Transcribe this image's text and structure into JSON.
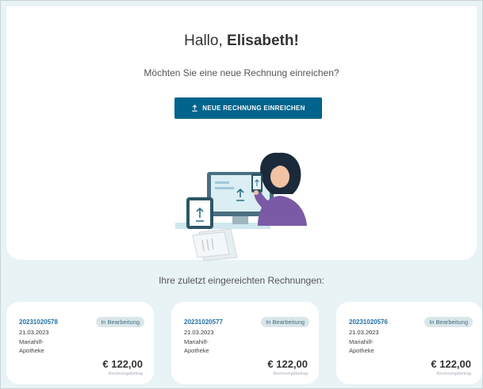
{
  "hero": {
    "greeting_prefix": "Hallo,",
    "greeting_name": "Elisabeth!",
    "subtitle": "Möchten Sie eine neue Rechnung einreichen?",
    "cta_label": "NEUE RECHNUNG EINREICHEN"
  },
  "recent": {
    "title": "Ihre zuletzt eingereichten Rechnungen:",
    "cards": [
      {
        "number": "20231020578",
        "status": "In Bearbeitung",
        "date": "21.03.2023",
        "pharmacy_line1": "Mariahilf-",
        "pharmacy_line2": "Apotheke",
        "amount": "€ 122,00",
        "amount_label": "Rechnungsbetrag"
      },
      {
        "number": "20231020577",
        "status": "In Bearbeitung",
        "date": "21.03.2023",
        "pharmacy_line1": "Mariahilf-",
        "pharmacy_line2": "Apotheke",
        "amount": "€ 122,00",
        "amount_label": "Rechnungsbetrag"
      },
      {
        "number": "20231020576",
        "status": "In Bearbeitung",
        "date": "21.03.2023",
        "pharmacy_line1": "Mariahilf-",
        "pharmacy_line2": "Apotheke",
        "amount": "€ 122,00",
        "amount_label": "Rechnungsbetrag"
      }
    ]
  },
  "colors": {
    "accent": "#00648c",
    "background": "#e8f3f6",
    "badge_bg": "#dbe6ea",
    "invoice_link": "#1f6fa5"
  },
  "icons": {
    "cta": "upload-icon"
  }
}
